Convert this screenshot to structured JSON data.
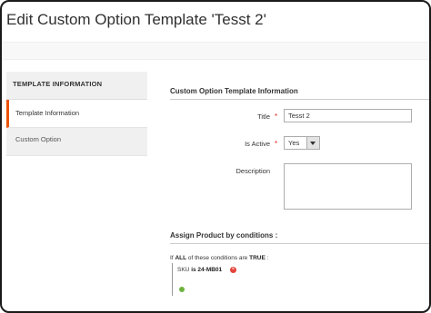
{
  "page": {
    "title": "Edit Custom Option Template 'Tesst 2'"
  },
  "sidebar": {
    "heading": "TEMPLATE INFORMATION",
    "items": [
      {
        "label": "Template Information",
        "active": true
      },
      {
        "label": "Custom Option",
        "active": false
      }
    ]
  },
  "form": {
    "section_title": "Custom Option Template Information",
    "title_label": "Title",
    "title_value": "Tesst 2",
    "is_active_label": "Is Active",
    "is_active_value": "Yes",
    "description_label": "Description",
    "description_value": ""
  },
  "conditions": {
    "section_title": "Assign Product by conditions :",
    "if_text": "If",
    "aggregator": "ALL",
    "of_these_text": "of these conditions are",
    "value": "TRUE",
    "colon": ":",
    "rule_attribute": "SKU",
    "rule_operator": "is",
    "rule_value": "24-MB01"
  },
  "colors": {
    "accent": "#eb5202",
    "required": "#e22626",
    "remove": "#e4423a",
    "add": "#6fb33f"
  }
}
